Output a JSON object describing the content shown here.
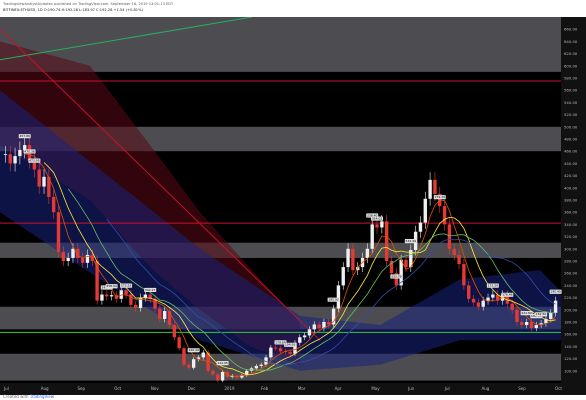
{
  "header": {
    "line1": "TradingviewAnalystUpdates published on TradingView.com, September 16, 2019 13:01:13 EDT",
    "line2": "BITFINEX:ETHUSD, 1D  O:190.74  H:192.28  L:183.97  C:192.28  +1.54 (+0.81%)"
  },
  "footer": {
    "prefix": "Created with",
    "brand": "TradingView"
  },
  "colors": {
    "background": "#000000",
    "zone": "#5b5b5f",
    "resistance_red": "#c8102e",
    "support_green": "#2ecc40",
    "trend_green": "#27ae60",
    "candle_up": "#f0f0f0",
    "candle_down": "#e53935"
  },
  "chart_data": {
    "type": "candlestick",
    "title": "",
    "xlabel": "",
    "ylabel": "",
    "ylim": [
      80,
      680
    ],
    "y_ticks": [
      "660.00",
      "640.00",
      "620.00",
      "600.00",
      "580.00",
      "560.00",
      "540.00",
      "520.00",
      "500.00",
      "480.00",
      "460.00",
      "440.00",
      "420.00",
      "400.00",
      "380.00",
      "360.00",
      "340.00",
      "320.00",
      "300.00",
      "280.00",
      "260.00",
      "240.00",
      "220.00",
      "200.00",
      "180.00",
      "160.00",
      "140.00",
      "120.00",
      "100.00"
    ],
    "x_ticks": [
      "Jul",
      "Aug",
      "Sep",
      "Oct",
      "Nov",
      "Dec",
      "2019",
      "Feb",
      "Mar",
      "Apr",
      "May",
      "Jun",
      "Jul",
      "Aug",
      "Sep",
      "Oct"
    ],
    "zones": [
      {
        "low": 590,
        "high": 680
      },
      {
        "low": 460,
        "high": 500
      },
      {
        "low": 285,
        "high": 310
      },
      {
        "low": 168,
        "high": 205
      },
      {
        "low": 84,
        "high": 128
      }
    ],
    "horizontal_lines": [
      {
        "value": 575,
        "color": "red"
      },
      {
        "value": 342,
        "color": "red"
      },
      {
        "value": 163,
        "color": "green"
      }
    ],
    "series": [
      {
        "values": [
          455,
          440,
          452,
          462,
          470,
          445,
          430,
          402,
          418,
          385,
          360,
          295,
          280,
          285,
          300,
          285,
          277,
          290,
          280,
          215,
          225,
          222,
          224,
          218,
          232,
          225,
          208,
          203,
          220,
          225,
          218,
          202,
          185,
          198,
          175,
          155,
          137,
          110,
          105,
          119,
          122,
          130,
          100,
          94,
          84,
          98,
          90,
          92,
          89,
          93,
          100,
          104,
          108,
          110,
          122,
          138,
          137,
          132,
          131,
          128,
          146,
          155,
          158,
          168,
          176,
          170,
          180,
          176,
          202,
          240,
          270,
          300,
          265,
          270,
          285,
          300,
          340,
          335,
          345,
          280,
          260,
          240,
          282,
          270,
          298,
          328,
          343,
          382,
          413,
          390,
          370,
          340,
          300,
          290,
          275,
          240,
          218,
          212,
          205,
          215,
          220,
          225,
          215,
          225,
          210,
          200,
          180,
          175,
          180,
          170,
          175,
          178,
          185,
          195,
          215
        ]
      }
    ],
    "price_labels": [
      "473.95",
      "457.86",
      "470.36",
      "245.41",
      "273.53",
      "302.27",
      "258.94",
      "140.40",
      "144.95",
      "178.88",
      "194.91",
      "185.92",
      "238.40",
      "354.01",
      "333.79",
      "532.99",
      "179.39",
      "172.59",
      "176.46",
      "222.80",
      "180.35",
      "162.50",
      "190.40"
    ]
  }
}
